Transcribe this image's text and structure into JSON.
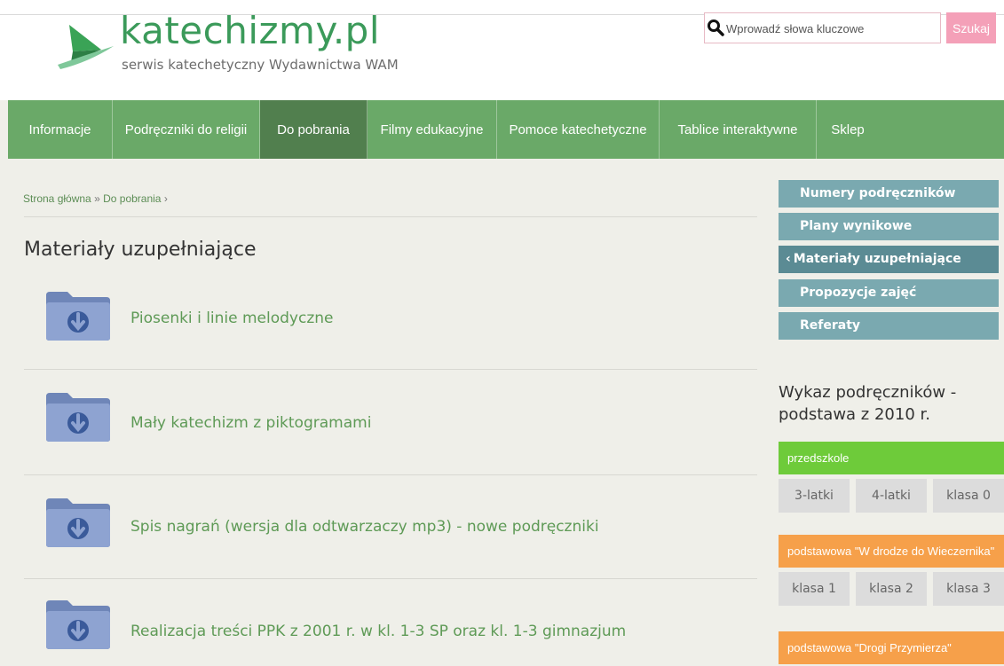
{
  "header": {
    "logo_title": "katechizmy.pl",
    "logo_subtitle": "serwis katechetyczny Wydawnictwa WAM",
    "search_placeholder": "Wprowadź słowa kluczowe",
    "search_button": "Szukaj"
  },
  "nav": {
    "items": [
      {
        "label": "Informacje"
      },
      {
        "label": "Podręczniki do religii"
      },
      {
        "label": "Do pobrania"
      },
      {
        "label": "Filmy edukacyjne"
      },
      {
        "label": "Pomoce katechetyczne"
      },
      {
        "label": "Tablice interaktywne"
      },
      {
        "label": "Sklep"
      }
    ],
    "active_index": 2
  },
  "breadcrumb": {
    "home": "Strona główna",
    "sep1": "»",
    "current": "Do pobrania",
    "sep2": "›"
  },
  "main": {
    "title": "Materiały uzupełniające",
    "downloads": [
      {
        "label": "Piosenki i linie melodyczne"
      },
      {
        "label": "Mały katechizm z piktogramami"
      },
      {
        "label": "Spis nagrań (wersja dla odtwarzaczy mp3) - nowe podręczniki"
      },
      {
        "label": "Realizacja treści PPK z 2001 r. w kl. 1-3 SP oraz kl. 1-3 gimnazjum"
      }
    ]
  },
  "sidebar": {
    "menu": [
      {
        "label": "Numery podręczników"
      },
      {
        "label": "Plany wynikowe"
      },
      {
        "label": "Materiały uzupełniające",
        "chevron": "‹"
      },
      {
        "label": "Propozycje zajęć"
      },
      {
        "label": "Referaty"
      }
    ],
    "wykaz_title": "Wykaz podręczników - podstawa z 2010 r.",
    "categories": [
      {
        "label": "przedszkole",
        "grades": [
          "3-latki",
          "4-latki",
          "klasa 0"
        ]
      },
      {
        "label": "podstawowa \"W drodze do Wieczernika\"",
        "grades": [
          "klasa 1",
          "klasa 2",
          "klasa 3"
        ]
      },
      {
        "label": "podstawowa \"Drogi Przymierza\""
      }
    ]
  },
  "colors": {
    "brand_green": "#3b9a5a",
    "nav_green": "#6aa968",
    "nav_active": "#517f4e",
    "link_green": "#5e9a56",
    "side_blue": "#7aa9b0",
    "side_active": "#5b8b94",
    "cat_green": "#6ecb3a",
    "cat_orange": "#f6a04a",
    "search_pink": "#f4a0b8"
  }
}
